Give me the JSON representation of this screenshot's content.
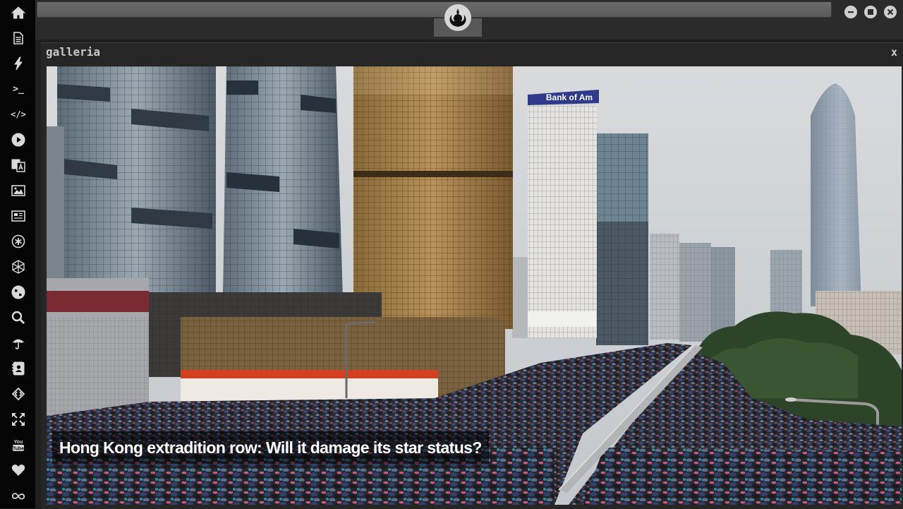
{
  "sidebar": {
    "items": [
      {
        "icon": "home-icon"
      },
      {
        "icon": "document-icon"
      },
      {
        "icon": "lightning-icon"
      },
      {
        "icon": "terminal-icon",
        "text": ">_"
      },
      {
        "icon": "code-icon",
        "text": "</>"
      },
      {
        "icon": "play-icon"
      },
      {
        "icon": "translate-icon"
      },
      {
        "icon": "image-icon"
      },
      {
        "icon": "newspaper-icon"
      },
      {
        "icon": "asterisk-circle-icon"
      },
      {
        "icon": "hexagon-icon"
      },
      {
        "icon": "globe-icon"
      },
      {
        "icon": "search-icon"
      },
      {
        "icon": "umbrella-icon"
      },
      {
        "icon": "contact-icon"
      },
      {
        "icon": "diamond-code-icon"
      },
      {
        "icon": "expand-icon"
      },
      {
        "icon": "youtube-icon",
        "text": "You Tube"
      },
      {
        "icon": "heart-icon"
      },
      {
        "icon": "infinity-cloud-icon"
      }
    ]
  },
  "topbar": {
    "logo_icon": "rebel-alliance-icon",
    "window_controls": [
      "minimize-icon",
      "maximize-icon",
      "close-icon"
    ]
  },
  "window": {
    "title": "galleria",
    "close_label": "x"
  },
  "gallery": {
    "caption": "Hong Kong extradition row: Will it damage its star status?",
    "sign_text": "Bank of Am"
  },
  "colors": {
    "sidebar_bg": "#050505",
    "window_bg": "#262626",
    "icon": "#d9d9d9"
  }
}
